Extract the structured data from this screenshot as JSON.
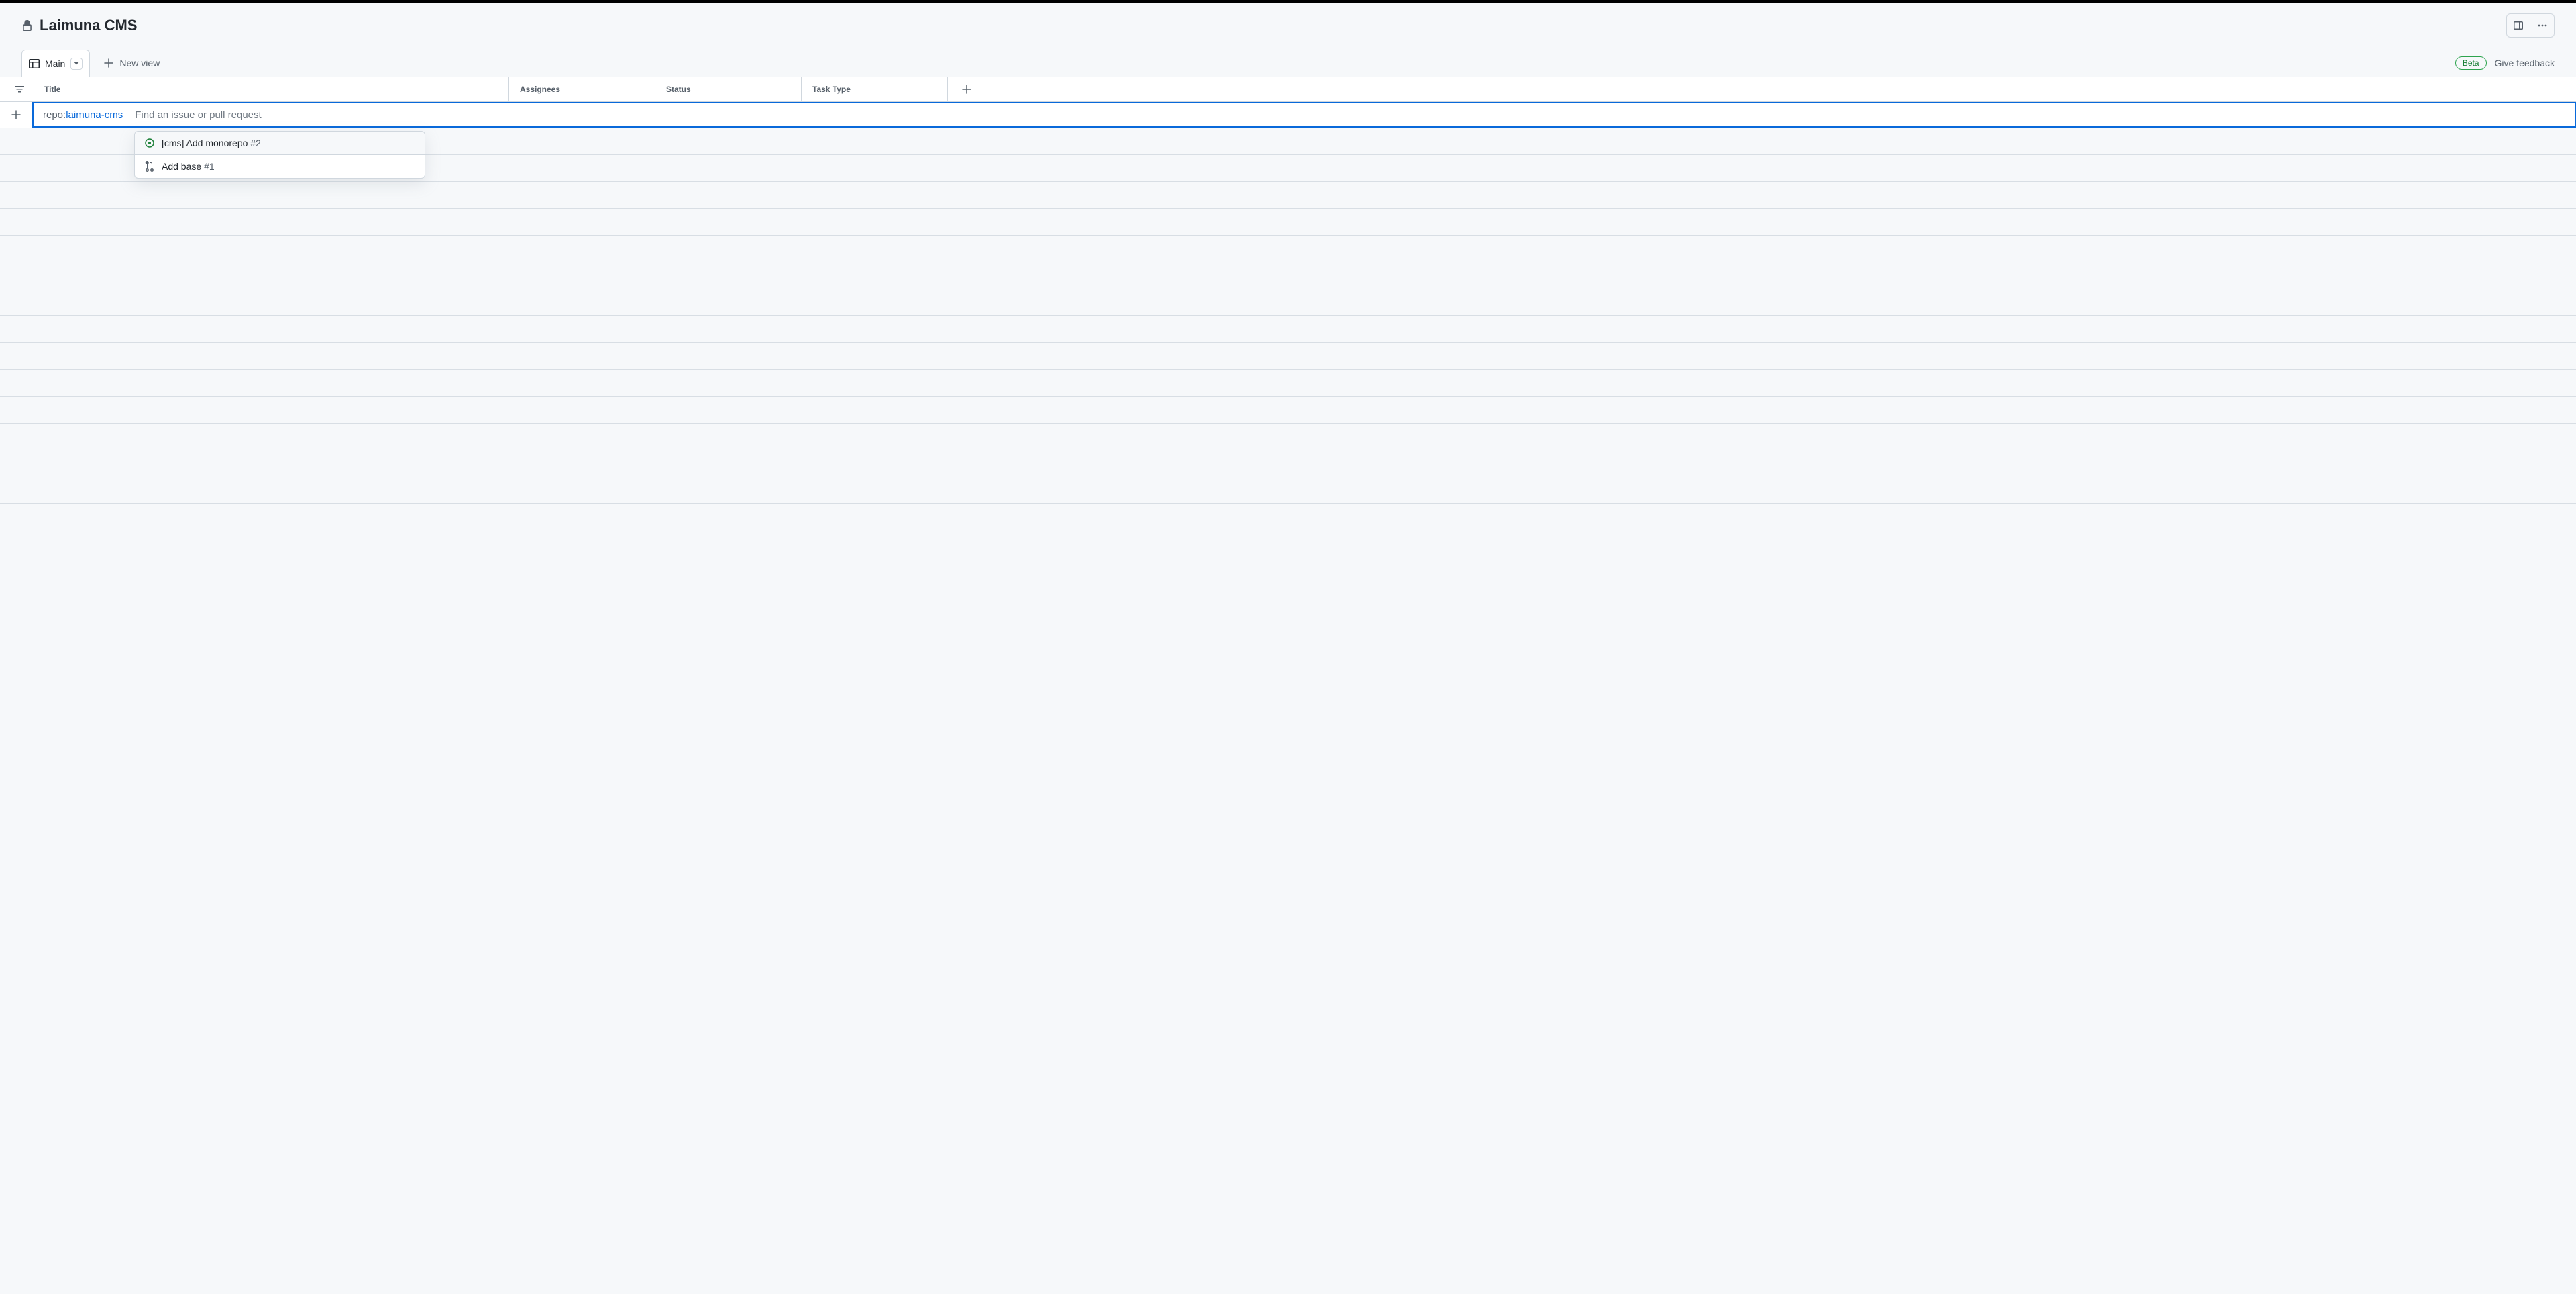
{
  "header": {
    "title": "Laimuna CMS"
  },
  "tabs": {
    "main_label": "Main",
    "new_view_label": "New view"
  },
  "feedback": {
    "beta_label": "Beta",
    "give_feedback_label": "Give feedback"
  },
  "columns": {
    "title": "Title",
    "assignees": "Assignees",
    "status": "Status",
    "task_type": "Task Type"
  },
  "input": {
    "repo_prefix": "repo:",
    "repo_value": "laimuna-cms",
    "placeholder": "Find an issue or pull request"
  },
  "suggestions": [
    {
      "type": "issue",
      "text": "[cms] Add monorepo",
      "number": "#2",
      "highlighted": true
    },
    {
      "type": "pr",
      "text": "Add base",
      "number": "#1",
      "highlighted": false
    }
  ]
}
